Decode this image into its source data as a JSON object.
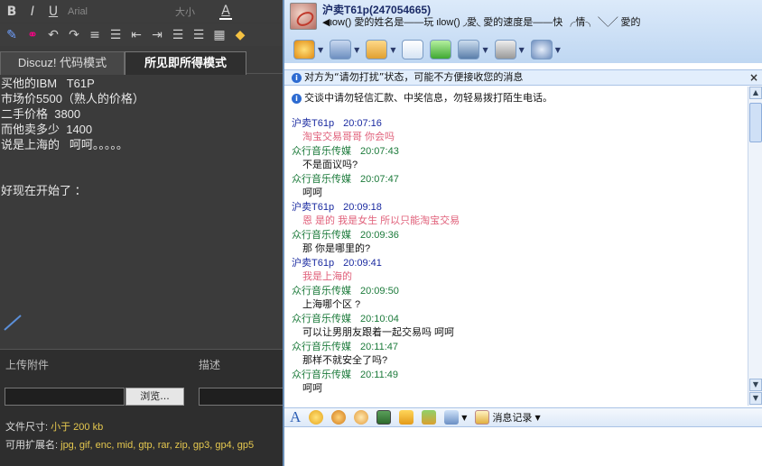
{
  "editor_toolbar": {
    "font": "Arial",
    "size": "大小"
  },
  "tabs": [
    {
      "label": "Discuz! 代码模式",
      "active": false
    },
    {
      "label": "所见即所得模式",
      "active": true
    }
  ],
  "editor_lines": [
    "买他的IBM   T61P",
    "市场价5500（熟人的价格）",
    "二手价格  3800",
    "而他卖多少  1400",
    "说是上海的   呵呵。。。。。",
    "",
    "",
    "好现在开始了 ："
  ],
  "upload": {
    "header_attach": "上传附件",
    "header_desc": "描述",
    "browse_label": "浏览...",
    "size_label": "文件尺寸:",
    "size_value": "小于  200 kb",
    "ext_label": "可用扩展名:",
    "ext_value": "jpg, gif, enc, mid, gtp, rar, zip, gp3, gp4, gp5"
  },
  "contact": {
    "name": "沪卖T61p(247054665)",
    "signature": "◀ιοw() 愛的姓名是——玩   ιlοw()   ◞愛◟   愛的速度是——快   ╭情╮   ╲╱   愛的"
  },
  "notices": {
    "dnd": "对方为“请勿打扰”状态，可能不方便接收您的消息",
    "warning": "交谈中请勿轻信汇款、中奖信息，勿轻易拨打陌生电话。"
  },
  "messages": [
    {
      "sender": "沪卖T61p",
      "time": "20:07:16",
      "text": "淘宝交易哥哥  你会吗",
      "side": "them"
    },
    {
      "sender": "众行音乐传媒",
      "time": "20:07:43",
      "text": "不是面议吗?",
      "side": "me"
    },
    {
      "sender": "众行音乐传媒",
      "time": "20:07:47",
      "text": "呵呵",
      "side": "me"
    },
    {
      "sender": "沪卖T61p",
      "time": "20:09:18",
      "text": "恩  是的  我是女生  所以只能淘宝交易",
      "side": "them"
    },
    {
      "sender": "众行音乐传媒",
      "time": "20:09:36",
      "text": "那    你是哪里的?",
      "side": "me"
    },
    {
      "sender": "沪卖T61p",
      "time": "20:09:41",
      "text": "我是上海的",
      "side": "them"
    },
    {
      "sender": "众行音乐传媒",
      "time": "20:09:50",
      "text": "上海哪个区    ?",
      "side": "me"
    },
    {
      "sender": "众行音乐传媒",
      "time": "20:10:04",
      "text": "可以让男朋友跟着一起交易吗    呵呵",
      "side": "me"
    },
    {
      "sender": "众行音乐传媒",
      "time": "20:11:47",
      "text": "那样不就安全了吗?",
      "side": "me"
    },
    {
      "sender": "众行音乐传媒",
      "time": "20:11:49",
      "text": "呵呵",
      "side": "me"
    }
  ],
  "format_toolbar": {
    "history": "消息记录"
  },
  "colors": {
    "them": "#1a2aa0",
    "them_msg": "#e0607a",
    "me": "#1b7a3a",
    "me_msg": "#111111"
  }
}
